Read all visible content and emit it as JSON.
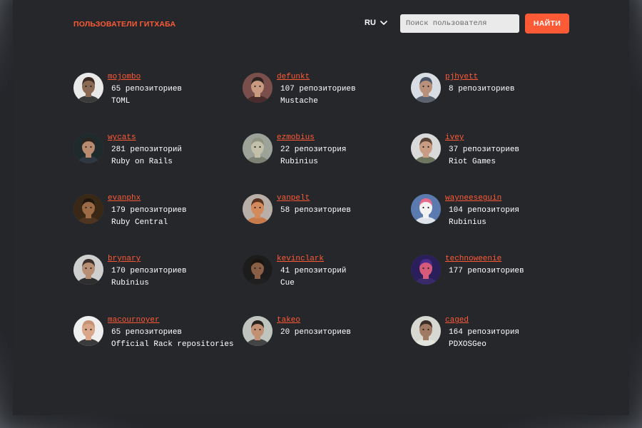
{
  "header": {
    "logo_text": "ПОЛЬЗОВАТЕЛИ ГИТХАБА",
    "language": "RU",
    "search_placeholder": "Поиск пользователя",
    "search_button": "НАЙТИ",
    "accent_color": "#ff5a36"
  },
  "users": [
    {
      "login": "mojombo",
      "repos": "65 репозиториев",
      "org": "TOML"
    },
    {
      "login": "defunkt",
      "repos": "107 репозиториев",
      "org": "Mustache"
    },
    {
      "login": "pjhyett",
      "repos": "8 репозиториев",
      "org": ""
    },
    {
      "login": "wycats",
      "repos": "281 репозиторий",
      "org": "Ruby on Rails"
    },
    {
      "login": "ezmobius",
      "repos": "22 репозитория",
      "org": "Rubinius"
    },
    {
      "login": "ivey",
      "repos": "37 репозиториев",
      "org": "Riot Games"
    },
    {
      "login": "evanphx",
      "repos": "179 репозиториев",
      "org": "Ruby Central"
    },
    {
      "login": "vanpelt",
      "repos": "58 репозиториев",
      "org": ""
    },
    {
      "login": "wayneeseguin",
      "repos": "104 репозитория",
      "org": "Rubinius"
    },
    {
      "login": "brynary",
      "repos": "170 репозиториев",
      "org": "Rubinius"
    },
    {
      "login": "kevinclark",
      "repos": "41 репозиторий",
      "org": "Cue"
    },
    {
      "login": "technoweenie",
      "repos": "177 репозиториев",
      "org": ""
    },
    {
      "login": "macournoyer",
      "repos": "65 репозиториев",
      "org": "Official Rack repositories"
    },
    {
      "login": "takeo",
      "repos": "20 репозиториев",
      "org": ""
    },
    {
      "login": "caged",
      "repos": "164 репозитория",
      "org": "PDXOSGeo"
    }
  ]
}
